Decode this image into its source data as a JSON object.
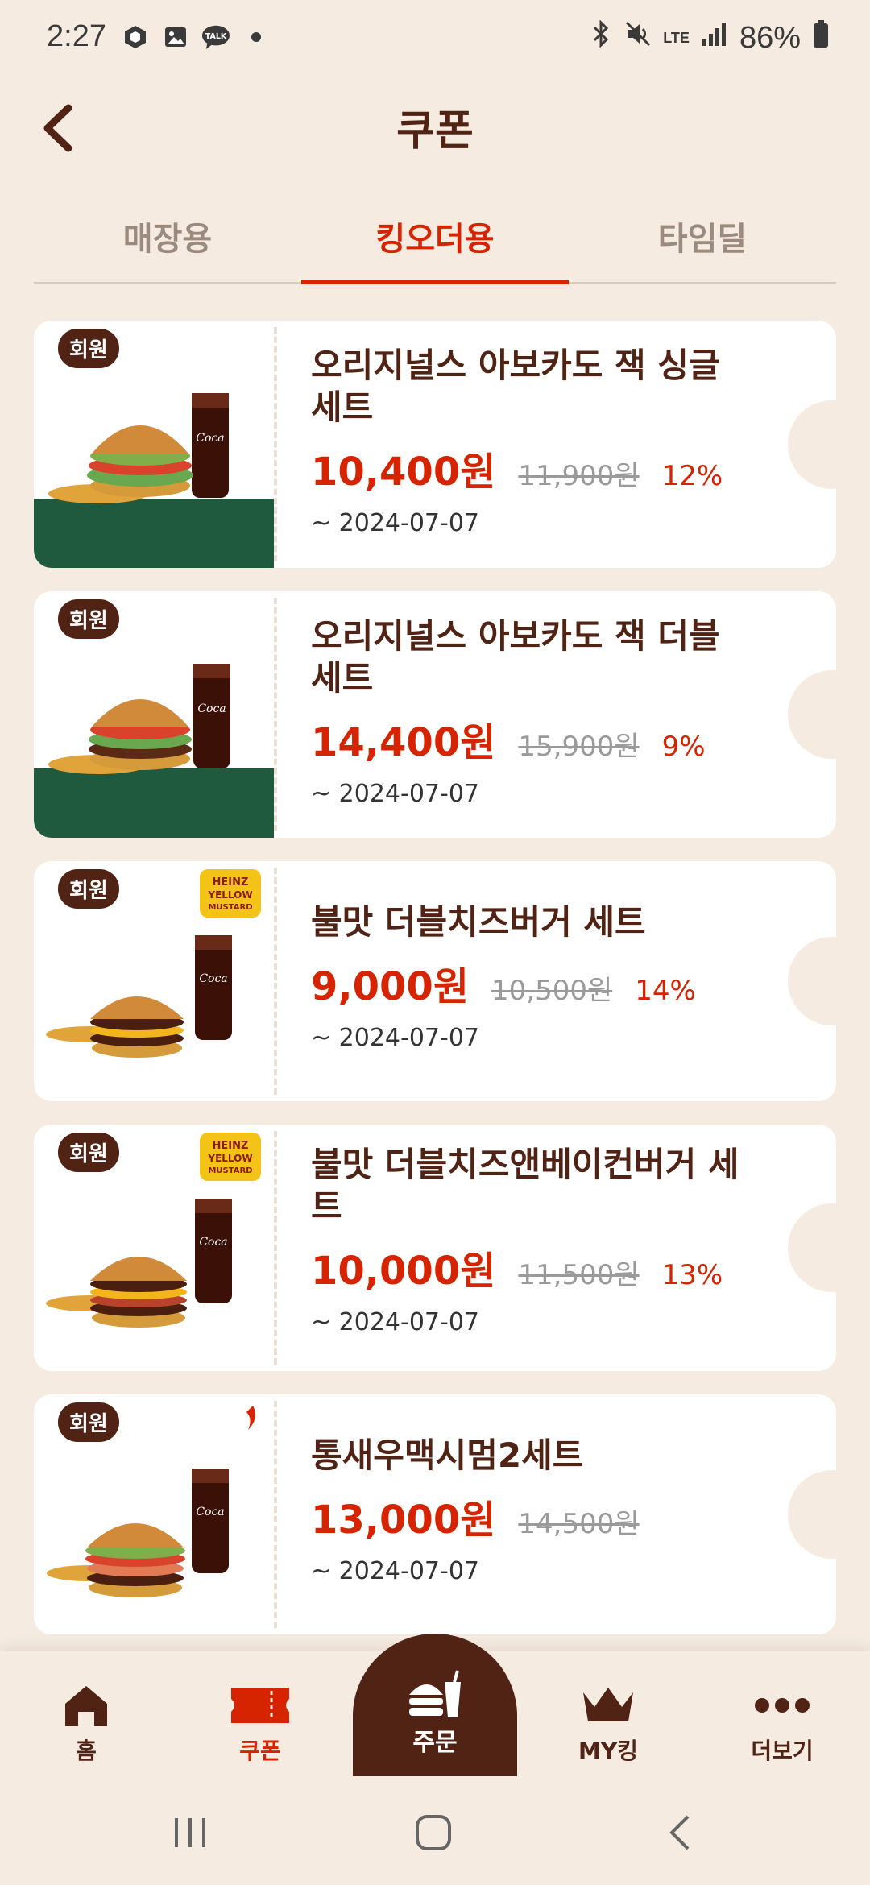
{
  "status": {
    "time": "2:27",
    "battery": "86%",
    "network": "LTE"
  },
  "header": {
    "title": "쿠폰"
  },
  "tabs": [
    {
      "label": "매장용"
    },
    {
      "label": "킹오더용"
    },
    {
      "label": "타임딜"
    }
  ],
  "coupons": [
    {
      "badge": "회원",
      "name_line1": "오리지널스 아보카도 잭 싱글",
      "name_line2": "세트",
      "price": "10,400원",
      "original": "11,900원",
      "discount": "12%",
      "valid": "~ 2024-07-07"
    },
    {
      "badge": "회원",
      "name_line1": "오리지널스 아보카도 잭 더블",
      "name_line2": "세트",
      "price": "14,400원",
      "original": "15,900원",
      "discount": "9%",
      "valid": "~ 2024-07-07"
    },
    {
      "badge": "회원",
      "name_line1": "불맛 더블치즈버거 세트",
      "price": "9,000원",
      "original": "10,500원",
      "discount": "14%",
      "valid": "~ 2024-07-07"
    },
    {
      "badge": "회원",
      "name_line1": "불맛 더블치즈앤베이컨버거 세",
      "name_line2": "트",
      "price": "10,000원",
      "original": "11,500원",
      "discount": "13%",
      "valid": "~ 2024-07-07"
    },
    {
      "badge": "회원",
      "name_line1": "통새우맥시멈2세트",
      "price": "13,000원",
      "original": "14,500원",
      "valid": "~ 2024-07-07"
    }
  ],
  "nav": {
    "home": "홈",
    "coupon": "쿠폰",
    "order": "주문",
    "myking": "MY킹",
    "more": "더보기"
  },
  "colors": {
    "accent": "#d62300",
    "brown": "#502314",
    "background": "#f5ebe0"
  }
}
